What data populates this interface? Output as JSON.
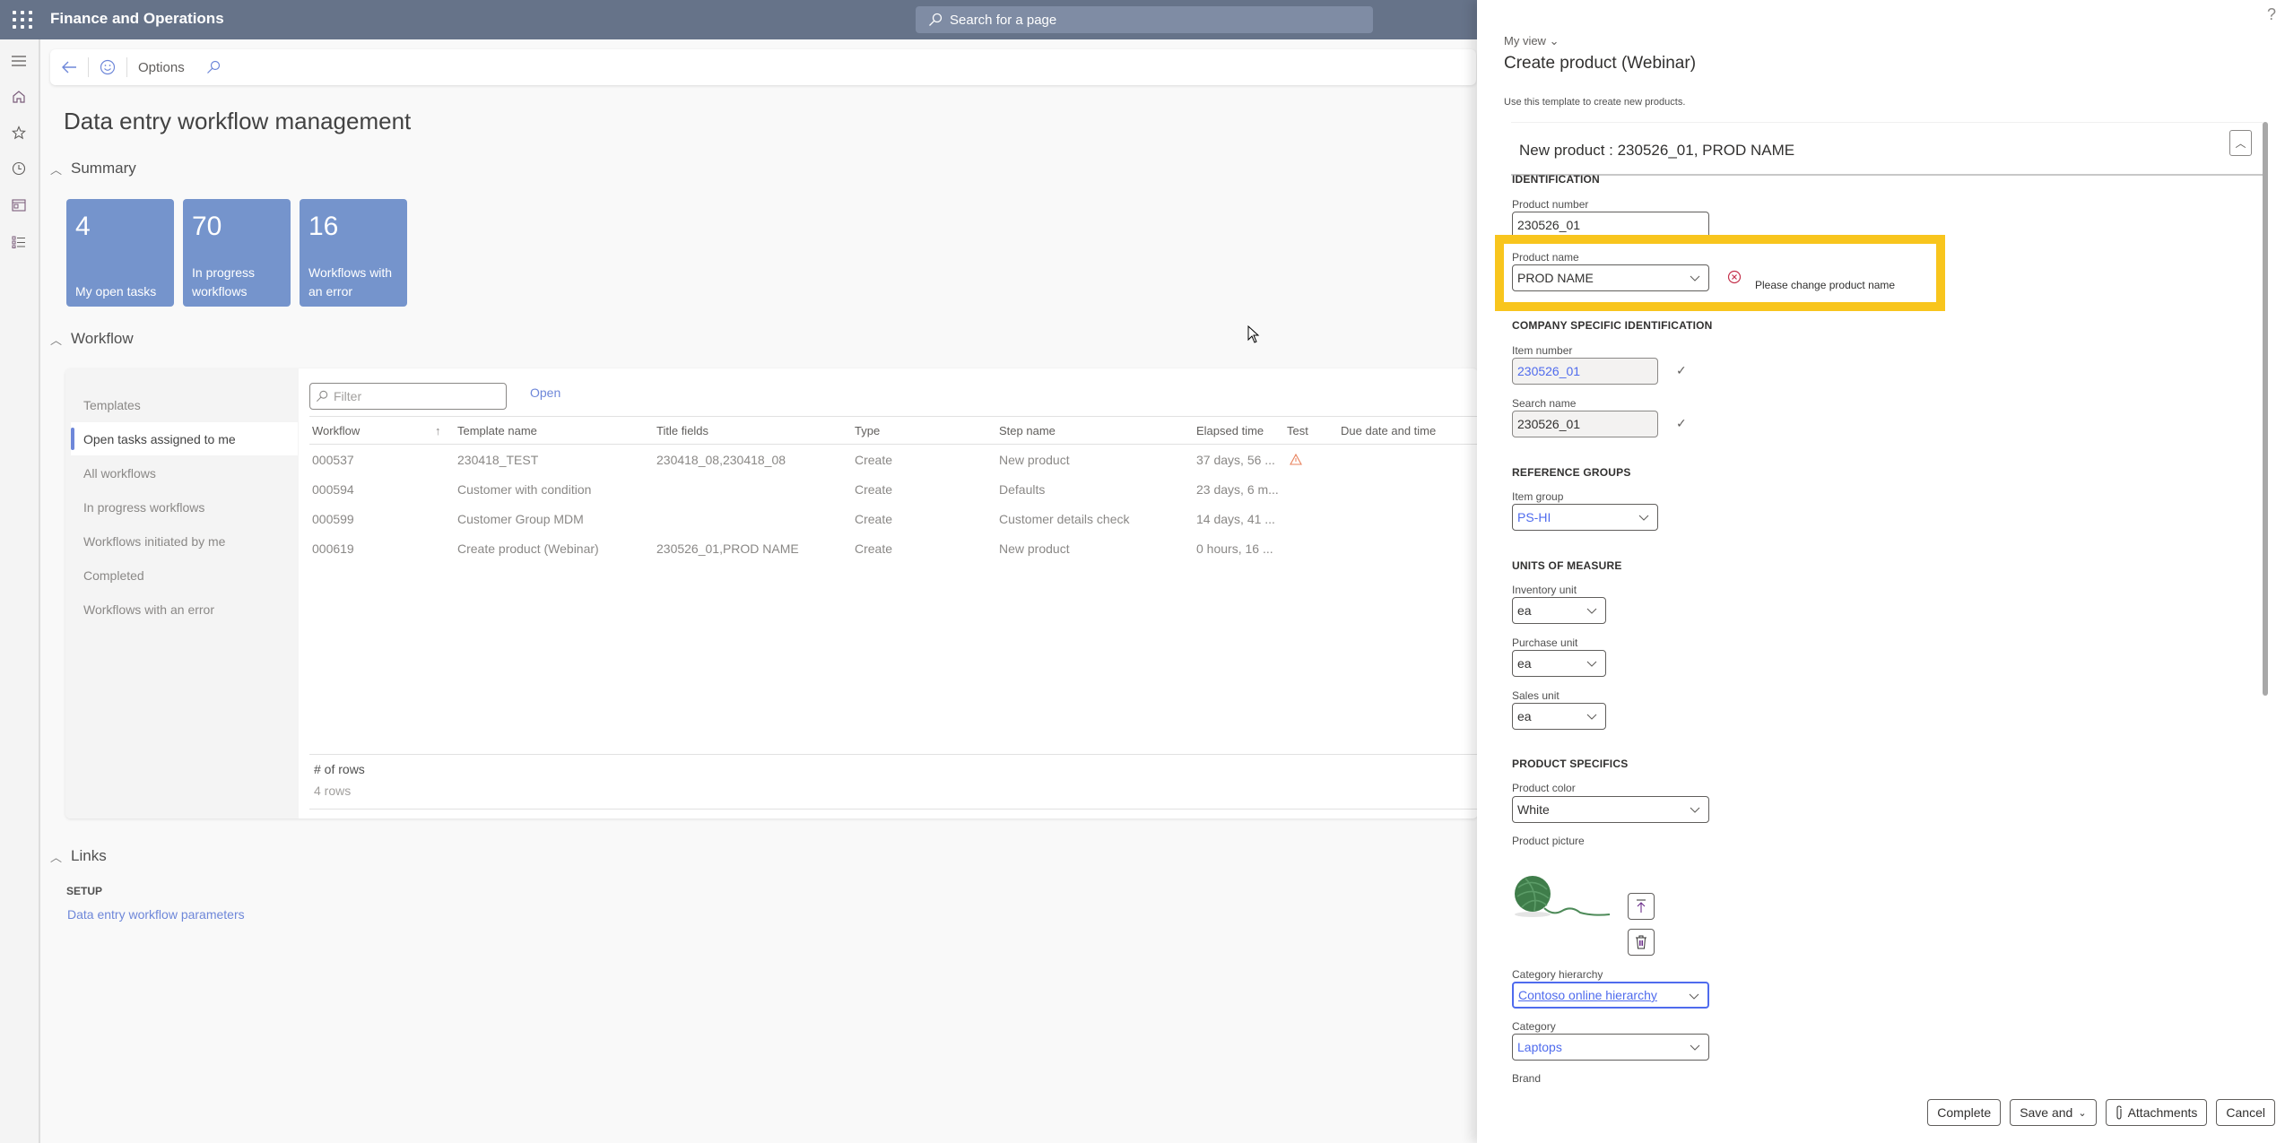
{
  "app": {
    "title": "Finance and Operations",
    "search_placeholder": "Search for a page"
  },
  "actionbar": {
    "options_label": "Options"
  },
  "page": {
    "title": "Data entry workflow management"
  },
  "summary": {
    "header": "Summary",
    "tiles": [
      {
        "count": "4",
        "label": "My open tasks"
      },
      {
        "count": "70",
        "label": "In progress workflows"
      },
      {
        "count": "16",
        "label": "Workflows with an error"
      }
    ],
    "tile_color": "#7594cc"
  },
  "workflow": {
    "header": "Workflow",
    "side_items": [
      {
        "label": "Templates",
        "active": false
      },
      {
        "label": "Open tasks assigned to me",
        "active": true
      },
      {
        "label": "All workflows",
        "active": false
      },
      {
        "label": "In progress workflows",
        "active": false
      },
      {
        "label": "Workflows initiated by me",
        "active": false
      },
      {
        "label": "Completed",
        "active": false
      },
      {
        "label": "Workflows with an error",
        "active": false
      }
    ],
    "filter_placeholder": "Filter",
    "open_label": "Open",
    "columns": [
      "Workflow",
      "Template name",
      "Title fields",
      "Type",
      "Step name",
      "Elapsed time",
      "Test",
      "Due date and time"
    ],
    "rows": [
      {
        "workflow": "000537",
        "template": "230418_TEST",
        "title_fields": "230418_08,230418_08",
        "type": "Create",
        "step": "New product",
        "elapsed": "37 days, 56 ...",
        "test": "warning"
      },
      {
        "workflow": "000594",
        "template": "Customer with condition",
        "title_fields": "",
        "type": "Create",
        "step": "Defaults",
        "elapsed": "23 days, 6 m...",
        "test": ""
      },
      {
        "workflow": "000599",
        "template": "Customer Group MDM",
        "title_fields": "",
        "type": "Create",
        "step": "Customer details check",
        "elapsed": "14 days, 41 ...",
        "test": ""
      },
      {
        "workflow": "000619",
        "template": "Create product (Webinar)",
        "title_fields": "230526_01,PROD NAME",
        "type": "Create",
        "step": "New product",
        "elapsed": "0 hours, 16 ...",
        "test": ""
      }
    ],
    "footer_label": "# of rows",
    "footer_value": "4 rows"
  },
  "links": {
    "header": "Links",
    "setup_label": "SETUP",
    "setup_link": "Data entry workflow parameters"
  },
  "panel": {
    "help": "?",
    "my_view": "My view",
    "title": "Create product (Webinar)",
    "description": "Use this template to create new products.",
    "fasttab_title": "New product : 230526_01, PROD NAME",
    "groups": {
      "identification": "IDENTIFICATION",
      "company": "COMPANY SPECIFIC IDENTIFICATION",
      "reference": "REFERENCE GROUPS",
      "units": "UNITS OF MEASURE",
      "specifics": "PRODUCT SPECIFICS"
    },
    "fields": {
      "product_number": {
        "label": "Product number",
        "value": "230526_01"
      },
      "product_name": {
        "label": "Product name",
        "value": "PROD NAME",
        "error": "Please change product name"
      },
      "item_number": {
        "label": "Item number",
        "value": "230526_01"
      },
      "search_name": {
        "label": "Search name",
        "value": "230526_01"
      },
      "item_group": {
        "label": "Item group",
        "value": "PS-HI"
      },
      "inventory_unit": {
        "label": "Inventory unit",
        "value": "ea"
      },
      "purchase_unit": {
        "label": "Purchase unit",
        "value": "ea"
      },
      "sales_unit": {
        "label": "Sales unit",
        "value": "ea"
      },
      "product_color": {
        "label": "Product color",
        "value": "White"
      },
      "product_picture": {
        "label": "Product picture"
      },
      "category_hierarchy": {
        "label": "Category hierarchy",
        "value": "Contoso online hierarchy"
      },
      "category": {
        "label": "Category",
        "value": "Laptops"
      },
      "brand": {
        "label": "Brand"
      }
    },
    "buttons": {
      "complete": "Complete",
      "save_and": "Save and",
      "attachments": "Attachments",
      "cancel": "Cancel"
    },
    "highlight_color": "#f8c51d",
    "error_color": "#c4314b"
  }
}
